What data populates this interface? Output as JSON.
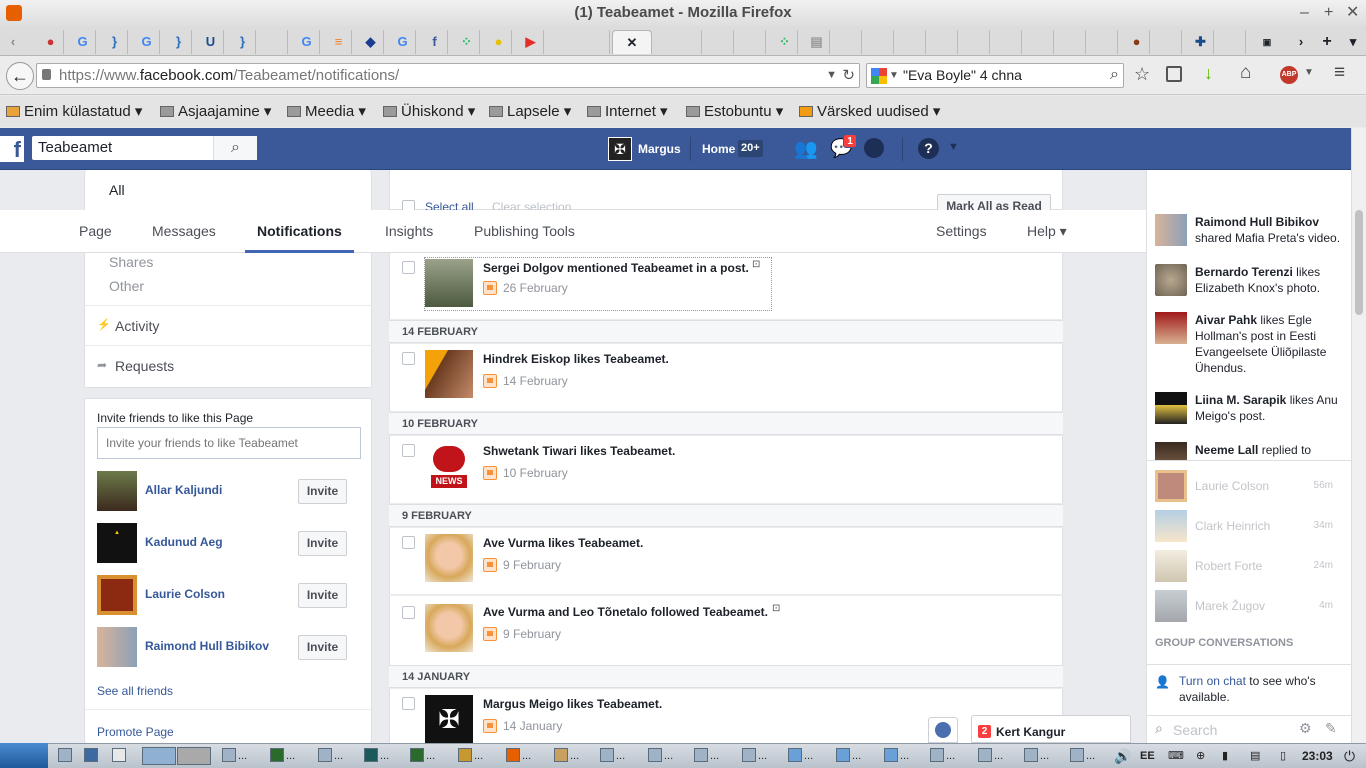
{
  "window": {
    "title": "(1) Teabeamet - Mozilla Firefox"
  },
  "tabs": {
    "active_close": "✕"
  },
  "navbar": {
    "url_prefix": "https://www.",
    "url_domain": "facebook.com",
    "url_path": "/Teabeamet/notifications/",
    "search_value": "\"Eva Boyle\" 4 chna"
  },
  "bookmarks": [
    {
      "label": "Enim külastatud"
    },
    {
      "label": "Asjaajamine"
    },
    {
      "label": "Meedia"
    },
    {
      "label": "Ühiskond"
    },
    {
      "label": "Lapsele"
    },
    {
      "label": "Internet"
    },
    {
      "label": "Estobuntu"
    },
    {
      "label": "Värsked uudised"
    }
  ],
  "fb": {
    "search_value": "Teabeamet",
    "user": "Margus",
    "home": "Home",
    "home_count": "20+",
    "messages_badge": "1"
  },
  "page_tabs": {
    "page": "Page",
    "messages": "Messages",
    "notifications": "Notifications",
    "insights": "Insights",
    "publishing": "Publishing Tools",
    "settings": "Settings",
    "help": "Help ▾"
  },
  "left": {
    "filters": {
      "all": "All",
      "shares": "Shares",
      "other": "Other"
    },
    "activity": "Activity",
    "requests": "Requests",
    "invite_title": "Invite friends to like this Page",
    "invite_placeholder": "Invite your friends to like Teabeamet",
    "invite_button": "Invite",
    "friends": [
      {
        "name": "Allar Kaljundi"
      },
      {
        "name": "Kadunud Aeg"
      },
      {
        "name": "Laurie Colson"
      },
      {
        "name": "Raimond Hull Bibikov"
      }
    ],
    "see_all": "See all friends",
    "promote": "Promote Page"
  },
  "center": {
    "select_all": "Select all",
    "clear_selection": "Clear selection",
    "mark_all_read": "Mark All as Read",
    "groups": [
      {
        "header": "",
        "items": [
          {
            "text": "Sergei Dolgov mentioned Teabeamet in a post.",
            "date": "26 February"
          }
        ]
      },
      {
        "header": "14 FEBRUARY",
        "items": [
          {
            "text": "Hindrek Eiskop likes Teabeamet.",
            "date": "14 February"
          }
        ]
      },
      {
        "header": "10 FEBRUARY",
        "items": [
          {
            "text": "Shwetank Tiwari likes Teabeamet.",
            "date": "10 February"
          }
        ]
      },
      {
        "header": "9 FEBRUARY",
        "items": [
          {
            "text": "Ave Vurma likes Teabeamet.",
            "date": "9 February"
          },
          {
            "text": "Ave Vurma and Leo Tõnetalo followed Teabeamet.",
            "date": "9 February"
          }
        ]
      },
      {
        "header": "14 JANUARY",
        "items": [
          {
            "text": "Margus Meigo likes Teabeamet.",
            "date": "14 January"
          }
        ]
      }
    ],
    "news_label": "NEWS"
  },
  "ticker": [
    {
      "name": "Raimond Hull Bibikov",
      "rest": " shared Mafia Preta's video."
    },
    {
      "name": "Bernardo Terenzi",
      "rest": " likes Elizabeth Knox's photo."
    },
    {
      "name": "Aivar Pahk",
      "rest": " likes Egle Hollman's post in Eesti Evangeelsete Üliõpilaste Ühendus."
    },
    {
      "name": "Liina M. Sarapik",
      "rest": " likes Anu Meigo's post."
    },
    {
      "name": "Neeme Lall",
      "rest": " replied to"
    }
  ],
  "chat": {
    "contacts": [
      {
        "name": "Laurie Colson",
        "time": "56m"
      },
      {
        "name": "Clark Heinrich",
        "time": "34m"
      },
      {
        "name": "Robert Forte",
        "time": "24m"
      },
      {
        "name": "Marek Žugov",
        "time": "4m"
      }
    ],
    "group_header": "GROUP CONVERSATIONS",
    "turn_on": "Turn on chat",
    "turn_on_rest": " to see who's available.",
    "search_placeholder": "Search",
    "popup_badge": "2",
    "popup_name": "Kert Kangur"
  },
  "taskbar": {
    "time": "23:03",
    "items_label": "..."
  },
  "colors": {
    "fb_blue": "#3b5998",
    "link": "#365899",
    "accent": "#4267b2",
    "badge": "#fa3e3e"
  }
}
